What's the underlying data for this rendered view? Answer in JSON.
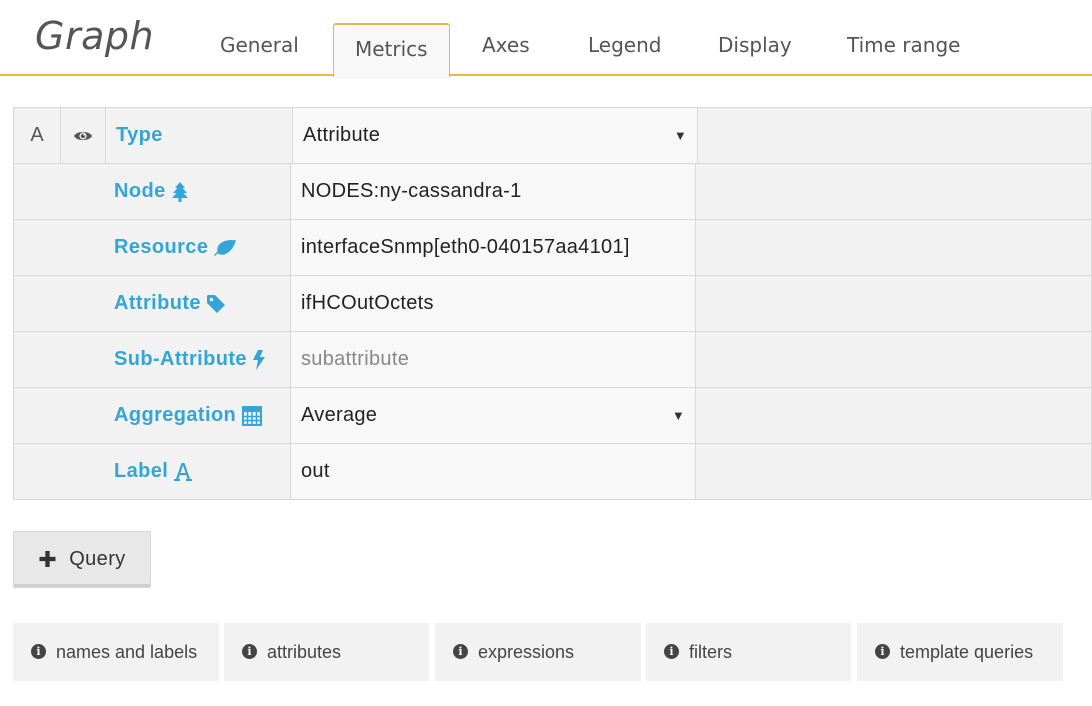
{
  "header": {
    "title": "Graph",
    "tabs": [
      {
        "label": "General"
      },
      {
        "label": "Metrics"
      },
      {
        "label": "Axes"
      },
      {
        "label": "Legend"
      },
      {
        "label": "Display"
      },
      {
        "label": "Time range"
      }
    ],
    "active_tab": "Metrics"
  },
  "query": {
    "ref_id": "A",
    "rows": {
      "type": {
        "label": "Type",
        "value": "Attribute"
      },
      "node": {
        "label": "Node",
        "value": "NODES:ny-cassandra-1",
        "icon": "tree-icon"
      },
      "resource": {
        "label": "Resource",
        "value": "interfaceSnmp[eth0-040157aa4101]",
        "icon": "leaf-icon"
      },
      "attribute": {
        "label": "Attribute",
        "value": "ifHCOutOctets",
        "icon": "tag-icon"
      },
      "subattribute": {
        "label": "Sub-Attribute",
        "placeholder": "subattribute",
        "icon": "bolt-icon"
      },
      "aggregation": {
        "label": "Aggregation",
        "value": "Average",
        "icon": "calculator-icon"
      },
      "label": {
        "label": "Label",
        "value": "out",
        "icon": "font-icon"
      }
    }
  },
  "buttons": {
    "add_query": "Query"
  },
  "help_tabs": [
    {
      "label": "names and labels"
    },
    {
      "label": "attributes"
    },
    {
      "label": "expressions"
    },
    {
      "label": "filters"
    },
    {
      "label": "template queries"
    }
  ],
  "colors": {
    "accent": "#e9b84a",
    "label_blue": "#33a6d6"
  }
}
